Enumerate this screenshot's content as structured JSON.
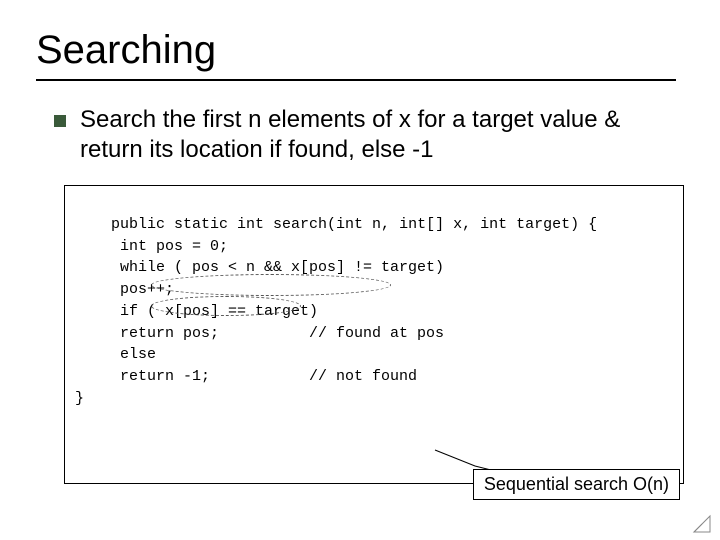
{
  "title": "Searching",
  "bullet": "Search the first n elements of x for a target value & return its location if found, else -1",
  "code": "public static int search(int n, int[] x, int target) {\n     int pos = 0;\n     while ( pos < n && x[pos] != target)\n     pos++;\n     if ( x[pos] == target)\n     return pos;          // found at pos\n     else\n     return -1;           // not found\n}",
  "callout": "Sequential search O(n)"
}
